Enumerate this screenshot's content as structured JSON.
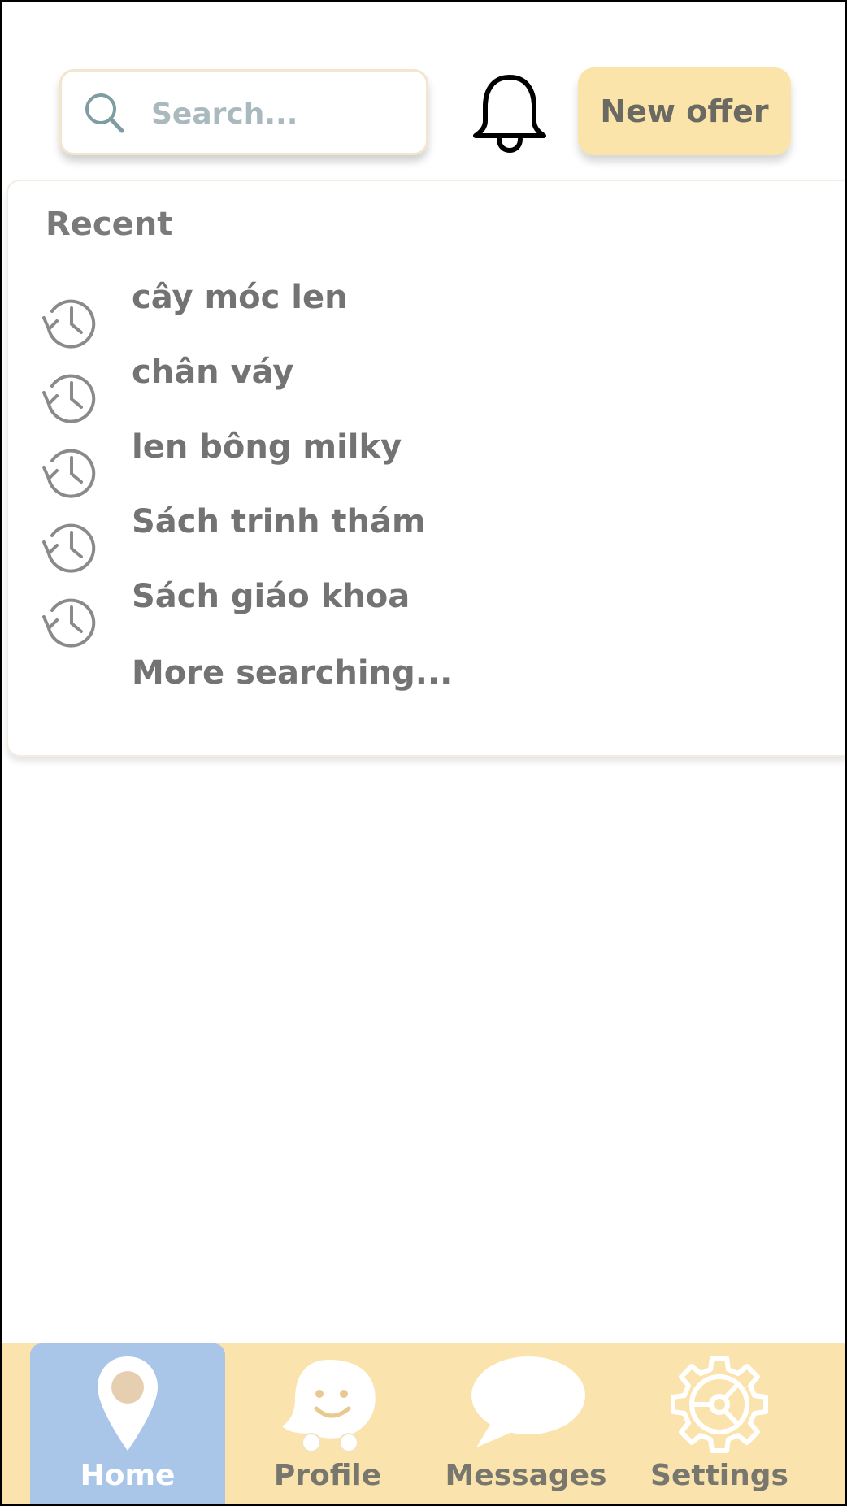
{
  "header": {
    "search": {
      "placeholder": "Search...",
      "value": ""
    },
    "notification_icon": "bell-icon",
    "new_offer_label": "New offer"
  },
  "recent": {
    "title": "Recent",
    "items": [
      {
        "label": "cây móc len",
        "icon": "history-icon"
      },
      {
        "label": "chân váy",
        "icon": "history-icon"
      },
      {
        "label": "len bông milky",
        "icon": "history-icon"
      },
      {
        "label": "Sách trinh thám",
        "icon": "history-icon"
      },
      {
        "label": "Sách giáo khoa",
        "icon": "history-icon"
      }
    ],
    "more_label": "More searching..."
  },
  "bottom_nav": {
    "active": "Home",
    "items": [
      {
        "label": "Home",
        "icon": "map-pin-icon"
      },
      {
        "label": "Profile",
        "icon": "smiley-ghost-icon"
      },
      {
        "label": "Messages",
        "icon": "speech-bubble-icon"
      },
      {
        "label": "Settings",
        "icon": "gear-icon"
      }
    ]
  },
  "colors": {
    "accent": "#fbe4a9",
    "nav_background": "#fae3ad",
    "nav_active": "#a9c6e8",
    "text_gray": "#737373"
  }
}
